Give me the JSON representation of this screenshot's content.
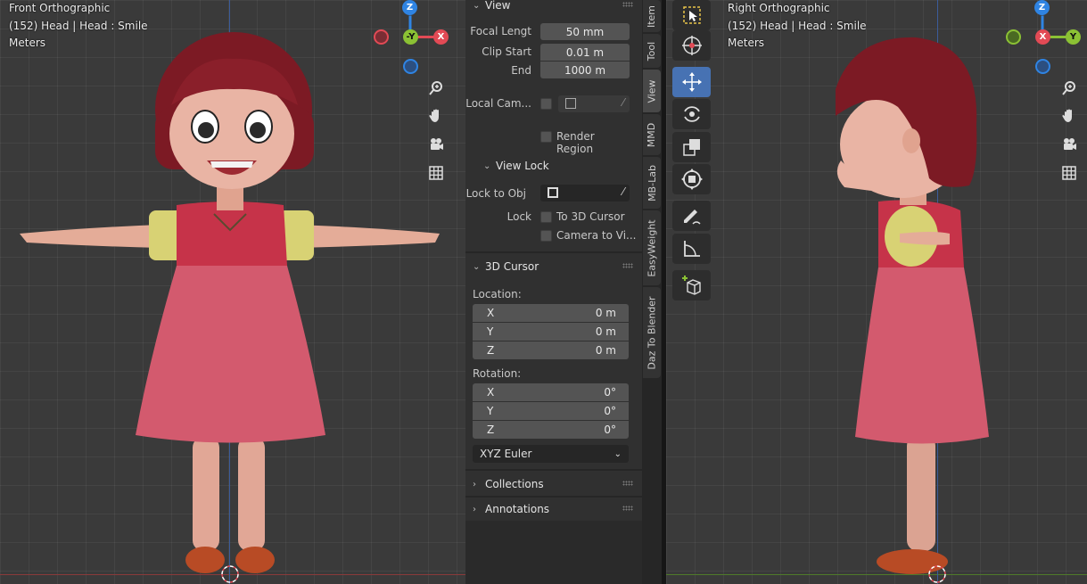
{
  "viewport_left": {
    "view_name": "Front Orthographic",
    "object_info": "(152) Head | Head : Smile",
    "units": "Meters",
    "gizmo": {
      "top": "Z",
      "center": "-Y",
      "right": "X"
    }
  },
  "viewport_right": {
    "view_name": "Right Orthographic",
    "object_info": "(152) Head | Head : Smile",
    "units": "Meters",
    "gizmo": {
      "top": "Z",
      "center": "X",
      "right": "Y"
    }
  },
  "panel": {
    "view_section": "View",
    "focal_length_label": "Focal Lengt",
    "focal_length_value": "50 mm",
    "clip_start_label": "Clip Start",
    "clip_start_value": "0.01 m",
    "clip_end_label": "End",
    "clip_end_value": "1000 m",
    "local_camera_label": "Local Cam...",
    "render_region_label": "Render Region",
    "view_lock_section": "View Lock",
    "lock_to_obj_label": "Lock to Obj",
    "lock_label": "Lock",
    "to_3d_cursor_label": "To 3D Cursor",
    "camera_to_view_label": "Camera to Vi...",
    "cursor_section": "3D Cursor",
    "location_label": "Location:",
    "location": [
      {
        "axis": "X",
        "value": "0 m"
      },
      {
        "axis": "Y",
        "value": "0 m"
      },
      {
        "axis": "Z",
        "value": "0 m"
      }
    ],
    "rotation_label": "Rotation:",
    "rotation": [
      {
        "axis": "X",
        "value": "0°"
      },
      {
        "axis": "Y",
        "value": "0°"
      },
      {
        "axis": "Z",
        "value": "0°"
      }
    ],
    "rotation_mode": "XYZ Euler",
    "collections_section": "Collections",
    "annotations_section": "Annotations"
  },
  "tabs": [
    "Item",
    "Tool",
    "View",
    "MMD",
    "MB-Lab",
    "EasyWeight",
    "Daz To Blender"
  ],
  "active_tab": "View",
  "tools": [
    "select-box",
    "cursor",
    "move",
    "rotate",
    "scale",
    "transform",
    "annotate",
    "measure",
    "add-cube"
  ],
  "active_tool": "move",
  "colors": {
    "x_axis": "#e24a55",
    "y_axis": "#8bc134",
    "z_axis": "#2f84e3",
    "active": "#4772b3"
  }
}
